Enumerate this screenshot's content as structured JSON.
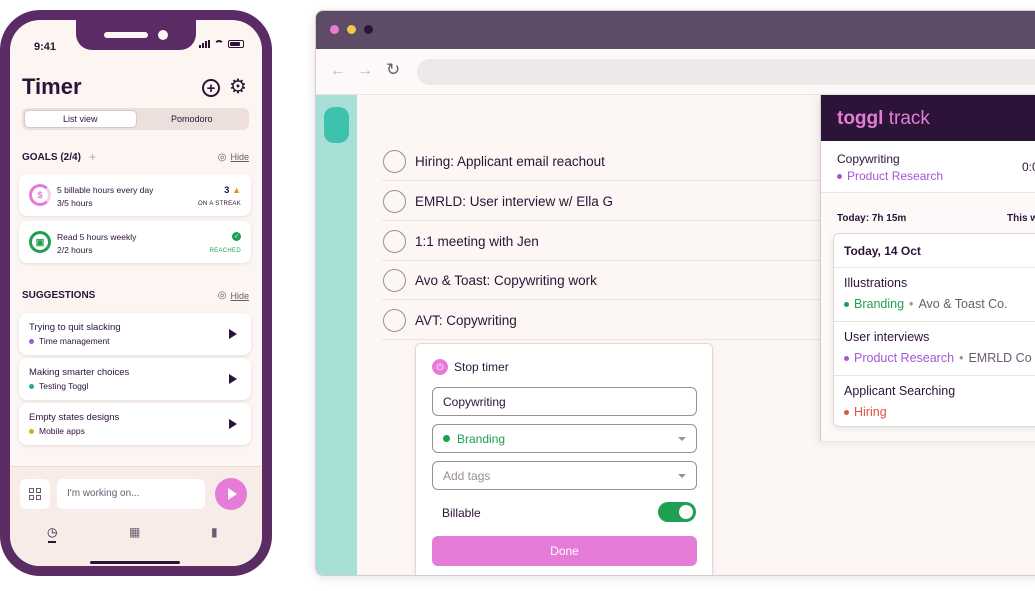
{
  "phone": {
    "status_time": "9:41",
    "title": "Timer",
    "tabs": [
      "List view",
      "Pomodoro"
    ],
    "goals": {
      "header": "GOALS (2/4)",
      "hide": "Hide",
      "items": [
        {
          "title": "5 billable hours every day",
          "sub": "3/5 hours",
          "count": "3",
          "status": "ON A STREAK",
          "ring_color": "#e57cd8"
        },
        {
          "title": "Read 5 hours weekly",
          "sub": "2/2 hours",
          "status": "REACHED",
          "ring_color": "#1f9f52"
        }
      ]
    },
    "suggestions": {
      "header": "SUGGESTIONS",
      "hide": "Hide",
      "items": [
        {
          "title": "Trying to quit slacking",
          "project": "Time management",
          "dot": "#a356d6"
        },
        {
          "title": "Making smarter choices",
          "project": "Testing Toggl",
          "dot": "#27a99a"
        },
        {
          "title": "Empty states designs",
          "project": "Mobile apps",
          "dot": "#c9b21d"
        }
      ]
    },
    "input_placeholder": "I'm working on...",
    "bottom_tabs": [
      "clock-icon",
      "calendar-icon",
      "bar-chart-icon"
    ]
  },
  "browser": {
    "tasks": [
      "Hiring: Applicant email reachout",
      "EMRLD: User interview w/ Ella G",
      "1:1 meeting with Jen",
      "Avo & Toast: Copywriting work",
      "AVT: Copywriting"
    ],
    "stop_panel": {
      "stop_label": "Stop timer",
      "description": "Copywriting",
      "project": "Branding",
      "tags_placeholder": "Add tags",
      "billable_label": "Billable",
      "billable_on": true,
      "done_label": "Done"
    }
  },
  "toggl": {
    "logo_bold": "toggl",
    "logo_rest": " track",
    "running": {
      "title": "Copywriting",
      "project": "Product Research",
      "duration": "0:0"
    },
    "today_total": "Today: 7h 15m",
    "week_label": "This w",
    "day_title": "Today, 14 Oct",
    "entries": [
      {
        "title": "Illustrations",
        "project": "Branding",
        "client": "Avo & Toast Co.",
        "color": "#1f9f52"
      },
      {
        "title": "User interviews",
        "project": "Product Research",
        "client": "EMRLD Co",
        "color": "#a356d6"
      },
      {
        "title": "Applicant Searching",
        "project": "Hiring",
        "client": "",
        "color": "#e0533d"
      }
    ]
  },
  "colors": {
    "accent": "#e57cd8",
    "brand_dark": "#2c1338",
    "green": "#1f9f52",
    "teal": "#a8e0d7"
  }
}
